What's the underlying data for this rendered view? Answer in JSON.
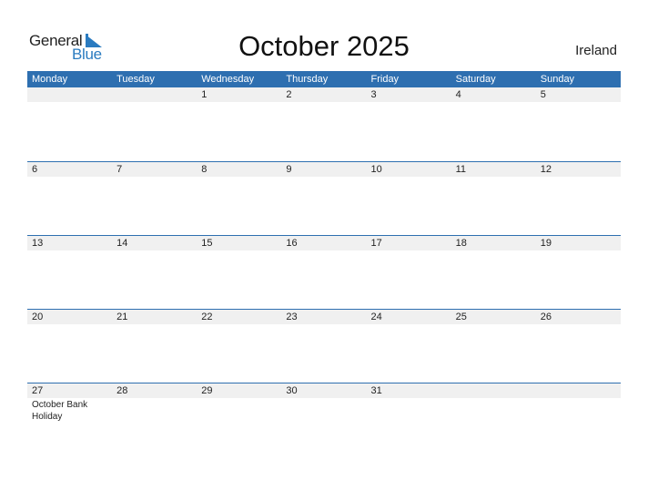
{
  "logo": {
    "word1": "General",
    "word2": "Blue"
  },
  "title": "October 2025",
  "country": "Ireland",
  "colors": {
    "header_bg": "#2e6fb0",
    "brand_blue": "#2a7bc0",
    "day_strip_bg": "#f0f0f0"
  },
  "weekdays": [
    "Monday",
    "Tuesday",
    "Wednesday",
    "Thursday",
    "Friday",
    "Saturday",
    "Sunday"
  ],
  "weeks": [
    {
      "days": [
        "",
        "",
        "1",
        "2",
        "3",
        "4",
        "5"
      ],
      "events": [
        "",
        "",
        "",
        "",
        "",
        "",
        ""
      ]
    },
    {
      "days": [
        "6",
        "7",
        "8",
        "9",
        "10",
        "11",
        "12"
      ],
      "events": [
        "",
        "",
        "",
        "",
        "",
        "",
        ""
      ]
    },
    {
      "days": [
        "13",
        "14",
        "15",
        "16",
        "17",
        "18",
        "19"
      ],
      "events": [
        "",
        "",
        "",
        "",
        "",
        "",
        ""
      ]
    },
    {
      "days": [
        "20",
        "21",
        "22",
        "23",
        "24",
        "25",
        "26"
      ],
      "events": [
        "",
        "",
        "",
        "",
        "",
        "",
        ""
      ]
    },
    {
      "days": [
        "27",
        "28",
        "29",
        "30",
        "31",
        "",
        ""
      ],
      "events": [
        "October Bank Holiday",
        "",
        "",
        "",
        "",
        "",
        ""
      ]
    }
  ]
}
